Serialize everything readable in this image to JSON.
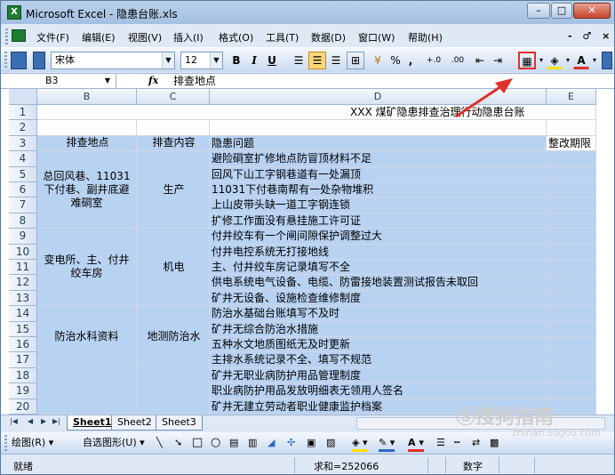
{
  "window": {
    "title": "Microsoft Excel - 隐患台账.xls",
    "app_icon": "X",
    "controls": {
      "minimize": "–",
      "maximize": "□",
      "close": "✕"
    }
  },
  "menu": {
    "items": [
      "文件(F)",
      "编辑(E)",
      "视图(V)",
      "插入(I)",
      "格式(O)",
      "工具(T)",
      "数据(D)",
      "窗口(W)",
      "帮助(H)"
    ],
    "doc_controls": "- ♂ ×"
  },
  "toolbar": {
    "font_name": "宋体",
    "font_size": "12",
    "bold": "B",
    "italic": "I",
    "underline": "U",
    "percent": "%",
    "comma": ",",
    "inc_decimal": "+.0",
    "dec_decimal": ".00"
  },
  "formula_bar": {
    "name_box": "B3",
    "fx": "fx",
    "value": "排查地点"
  },
  "columns": [
    "B",
    "C",
    "D",
    "E"
  ],
  "rows": [
    "1",
    "2",
    "3",
    "4",
    "5",
    "6",
    "7",
    "8",
    "9",
    "10",
    "11",
    "12",
    "13",
    "14",
    "15",
    "16",
    "17",
    "18",
    "19",
    "20"
  ],
  "sheet": {
    "title": "XXX 煤矿隐患排查治理行动隐患台账",
    "headers": {
      "b": "排查地点",
      "c": "排查内容",
      "d": "隐患问题",
      "e": "整改期限"
    },
    "groups": [
      {
        "place": "总回风巷、11031下付巷、副井底避难硐室",
        "content": "生产"
      },
      {
        "place": "变电所、主、付井绞车房",
        "content": "机电"
      },
      {
        "place": "防治水科资料",
        "content": "地测防治水"
      }
    ],
    "issues": [
      "避险硐室扩修地点防冒顶材料不足",
      "回风下山工字钢巷道有一处漏顶",
      "11031下付巷南帮有一处杂物堆积",
      "上山皮带头缺一道工字钢连锁",
      "扩修工作面没有悬挂施工许可证",
      "付井绞车有一个闸间隙保护调整过大",
      "付井电控系统无打接地线",
      "主、付井绞车房记录填写不全",
      "供电系统电气设备、电缆、防雷接地装置测试报告未取回",
      "矿井无设备、设施检查维修制度",
      "防治水基础台账填写不及时",
      "矿井无综合防治水措施",
      "五种水文地质图纸无及时更新",
      "主排水系统记录不全、填写不规范",
      "矿井无职业病防护用品管理制度",
      "职业病防护用品发放明细表无领用人签名",
      "矿井无建立劳动者职业健康监护档案"
    ]
  },
  "sheet_tabs": [
    "Sheet1",
    "Sheet2",
    "Sheet3"
  ],
  "draw_toolbar": {
    "draw": "绘图(R)",
    "autoshapes": "自选图形(U)"
  },
  "status": {
    "ready": "就绪",
    "sum": "求和=252066",
    "mode": "数字"
  },
  "watermark": {
    "main": "搜狗指南",
    "url": "zhinan.sogou.com"
  },
  "colors": {
    "selection": "#b8d2f2",
    "annotation_arrow": "#e0302a",
    "highlight_box": "#e0302a"
  }
}
